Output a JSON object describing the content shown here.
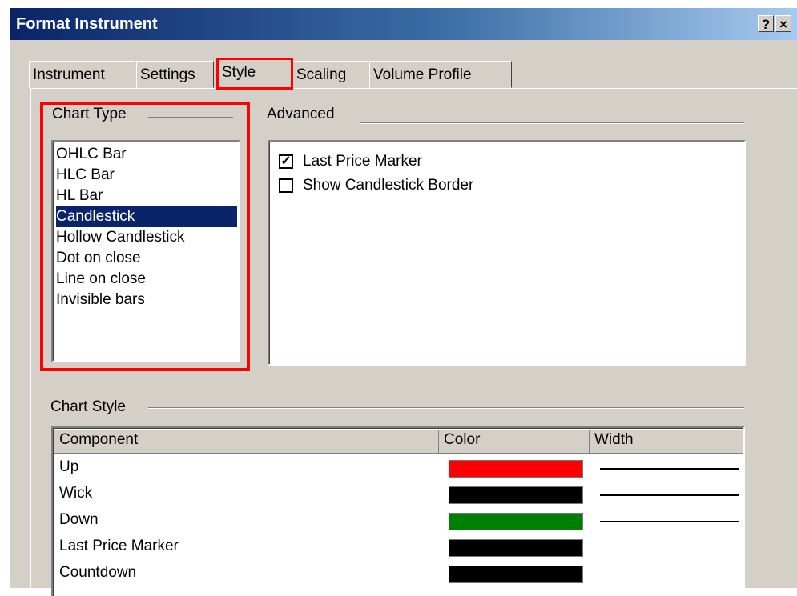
{
  "window": {
    "title": "Format Instrument",
    "help_label": "?",
    "close_label": "×"
  },
  "tabs": [
    {
      "label": "Instrument"
    },
    {
      "label": "Settings"
    },
    {
      "label": "Style"
    },
    {
      "label": "Scaling"
    },
    {
      "label": "Volume Profile"
    }
  ],
  "active_tab": "Style",
  "chart_type": {
    "label": "Chart Type",
    "items": [
      "OHLC Bar",
      "HLC Bar",
      "HL Bar",
      "Candlestick",
      "Hollow Candlestick",
      "Dot on close",
      "Line on close",
      "Invisible bars"
    ],
    "selected": "Candlestick"
  },
  "advanced": {
    "label": "Advanced",
    "options": [
      {
        "label": "Last Price Marker",
        "checked": true
      },
      {
        "label": "Show Candlestick Border",
        "checked": false
      }
    ]
  },
  "chart_style": {
    "label": "Chart Style",
    "headers": {
      "component": "Component",
      "color": "Color",
      "width": "Width"
    },
    "rows": [
      {
        "component": "Up",
        "color": "#ff0000",
        "has_width": true
      },
      {
        "component": "Wick",
        "color": "#000000",
        "has_width": true
      },
      {
        "component": "Down",
        "color": "#008000",
        "has_width": true
      },
      {
        "component": "Last Price Marker",
        "color": "#000000",
        "has_width": false
      },
      {
        "component": "Countdown",
        "color": "#000000",
        "has_width": false
      }
    ]
  },
  "colors": {
    "highlight": "#ff0000",
    "selection": "#0a246a"
  }
}
